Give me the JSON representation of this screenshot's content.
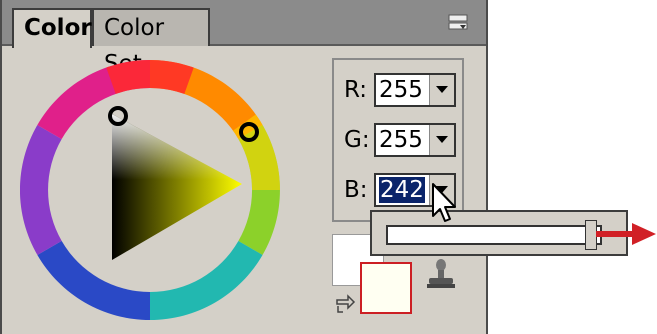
{
  "tabs": [
    {
      "label": "Color"
    },
    {
      "label": "Color Set"
    }
  ],
  "channels": [
    {
      "label": "R:",
      "value": "255"
    },
    {
      "label": "G:",
      "value": "255"
    },
    {
      "label": "B:",
      "value": "242"
    }
  ],
  "slider": {
    "value_fraction": 0.95
  },
  "colors": {
    "current": "#fffff2",
    "background": "#ffffff",
    "accent_red": "#d12026"
  },
  "icons": [
    "panel-menu-icon",
    "dropdown-arrow-icon",
    "swap-colors-icon",
    "stamp-icon",
    "pointer-cursor-icon",
    "red-arrow-icon"
  ]
}
